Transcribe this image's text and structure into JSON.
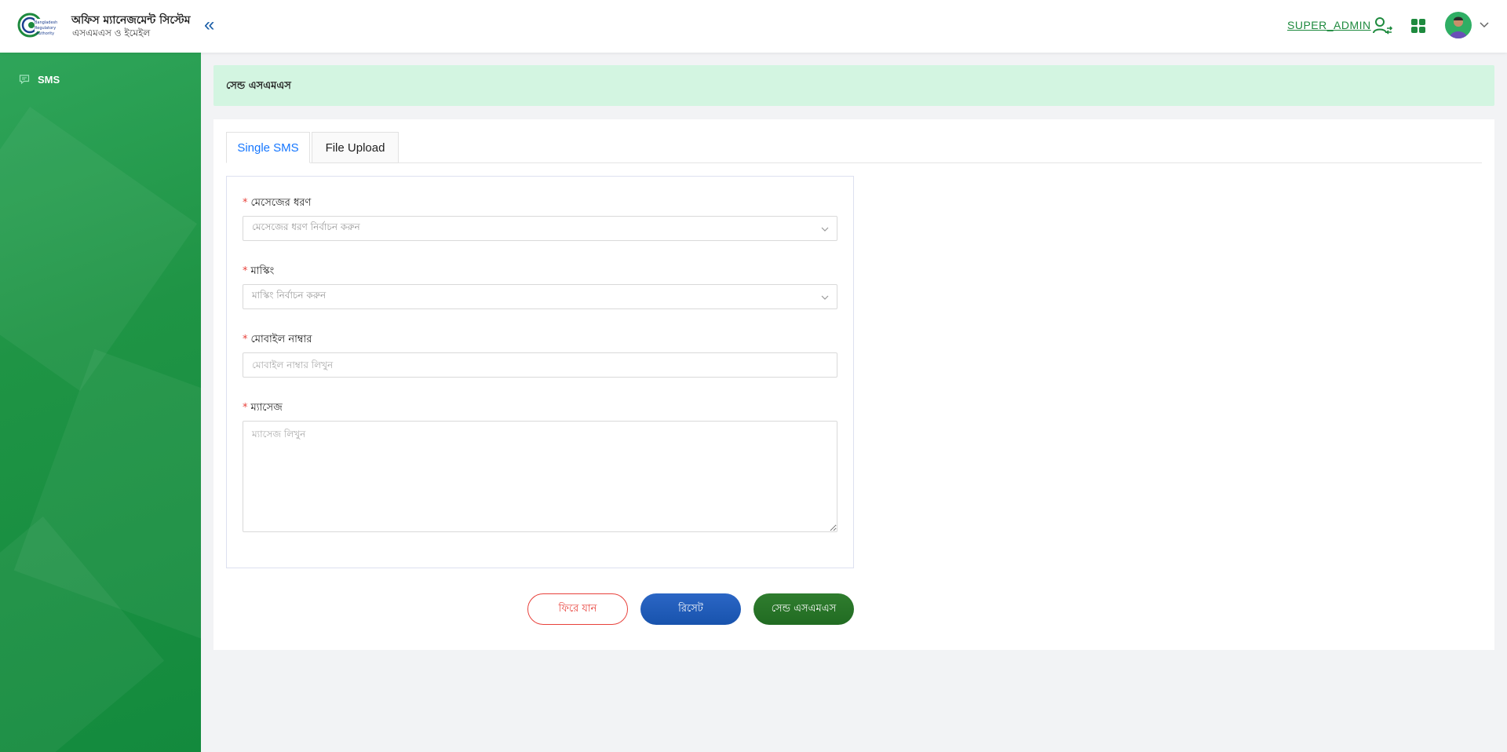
{
  "header": {
    "app_title": "অফিস ম্যানেজমেন্ট সিস্টেম",
    "app_subtitle": "এসএমএস ও ইমেইল",
    "collapse_glyph": "«",
    "user_name": "SUPER_ADMIN"
  },
  "sidebar": {
    "items": [
      {
        "label": "SMS",
        "icon": "message-icon"
      }
    ]
  },
  "page": {
    "banner_title": "সেন্ড এসএমএস"
  },
  "tabs": [
    {
      "label": "Single SMS",
      "active": true
    },
    {
      "label": "File Upload",
      "active": false
    }
  ],
  "form": {
    "message_type": {
      "label": "মেসেজের ধরণ",
      "placeholder": "মেসেজের ধরণ নির্বাচন করুন"
    },
    "masking": {
      "label": "মাস্কিং",
      "placeholder": "মাস্কিং নির্বাচন করুন"
    },
    "mobile": {
      "label": "মোবাইল নাম্বার",
      "placeholder": "মোবাইল নাম্বার লিখুন"
    },
    "message": {
      "label": "ম্যাসেজ",
      "placeholder": "ম্যাসেজ লিখুন"
    },
    "required_mark": "*"
  },
  "buttons": {
    "back": "ফিরে যান",
    "reset": "রিসেট",
    "send": "সেন্ড এসএমএস"
  },
  "colors": {
    "primary_green": "#1e8a3e",
    "sidebar_green": "#1f9445",
    "banner_bg": "#d3f5e1",
    "tab_active": "#1677ff",
    "danger": "#e8413b",
    "reset_blue": "#1f5bb8",
    "send_green": "#277427"
  }
}
